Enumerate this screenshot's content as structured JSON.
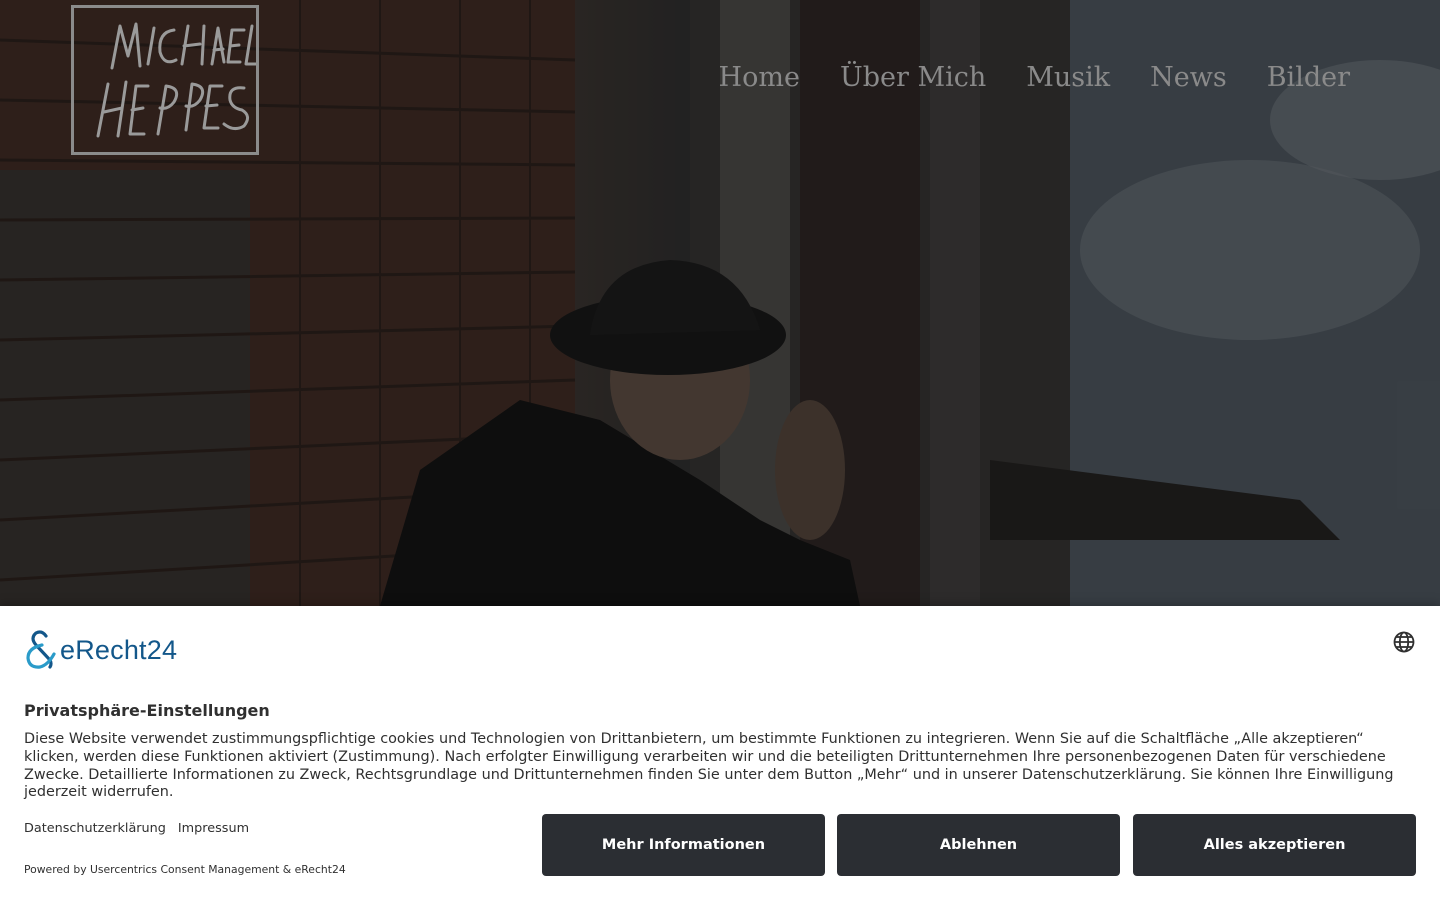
{
  "site": {
    "logo_text": "MICHAEL HEPPES",
    "nav": [
      "Home",
      "Über Mich",
      "Musik",
      "News",
      "Bilder"
    ]
  },
  "consent": {
    "brand": "eRecht24",
    "language_icon": "globe-icon",
    "title": "Privatsphäre-Einstellungen",
    "body": "Diese Website verwendet zustimmungspflichtige cookies und Technologien von Drittanbietern, um bestimmte Funktionen zu integrieren. Wenn Sie auf die Schaltfläche „Alle akzeptieren“ klicken, werden diese Funktionen aktiviert (Zustimmung). Nach erfolgter Einwilligung verarbeiten wir und die beteiligten Drittunternehmen Ihre personenbezogenen Daten für verschiedene Zwecke. Detaillierte Informationen zu Zweck, Rechtsgrundlage und Drittunternehmen finden Sie unter dem Button „Mehr“ und in unserer Datenschutzerklärung. Sie können Ihre Einwilligung jederzeit widerrufen.",
    "links": [
      "Datenschutzerklärung",
      "Impressum"
    ],
    "powered_by": "Powered by Usercentrics Consent Management & eRecht24",
    "buttons": {
      "more": "Mehr Informationen",
      "deny": "Ablehnen",
      "accept": "Alles akzeptieren"
    },
    "brand_color": "#13578a",
    "button_color": "#2b2e33"
  }
}
